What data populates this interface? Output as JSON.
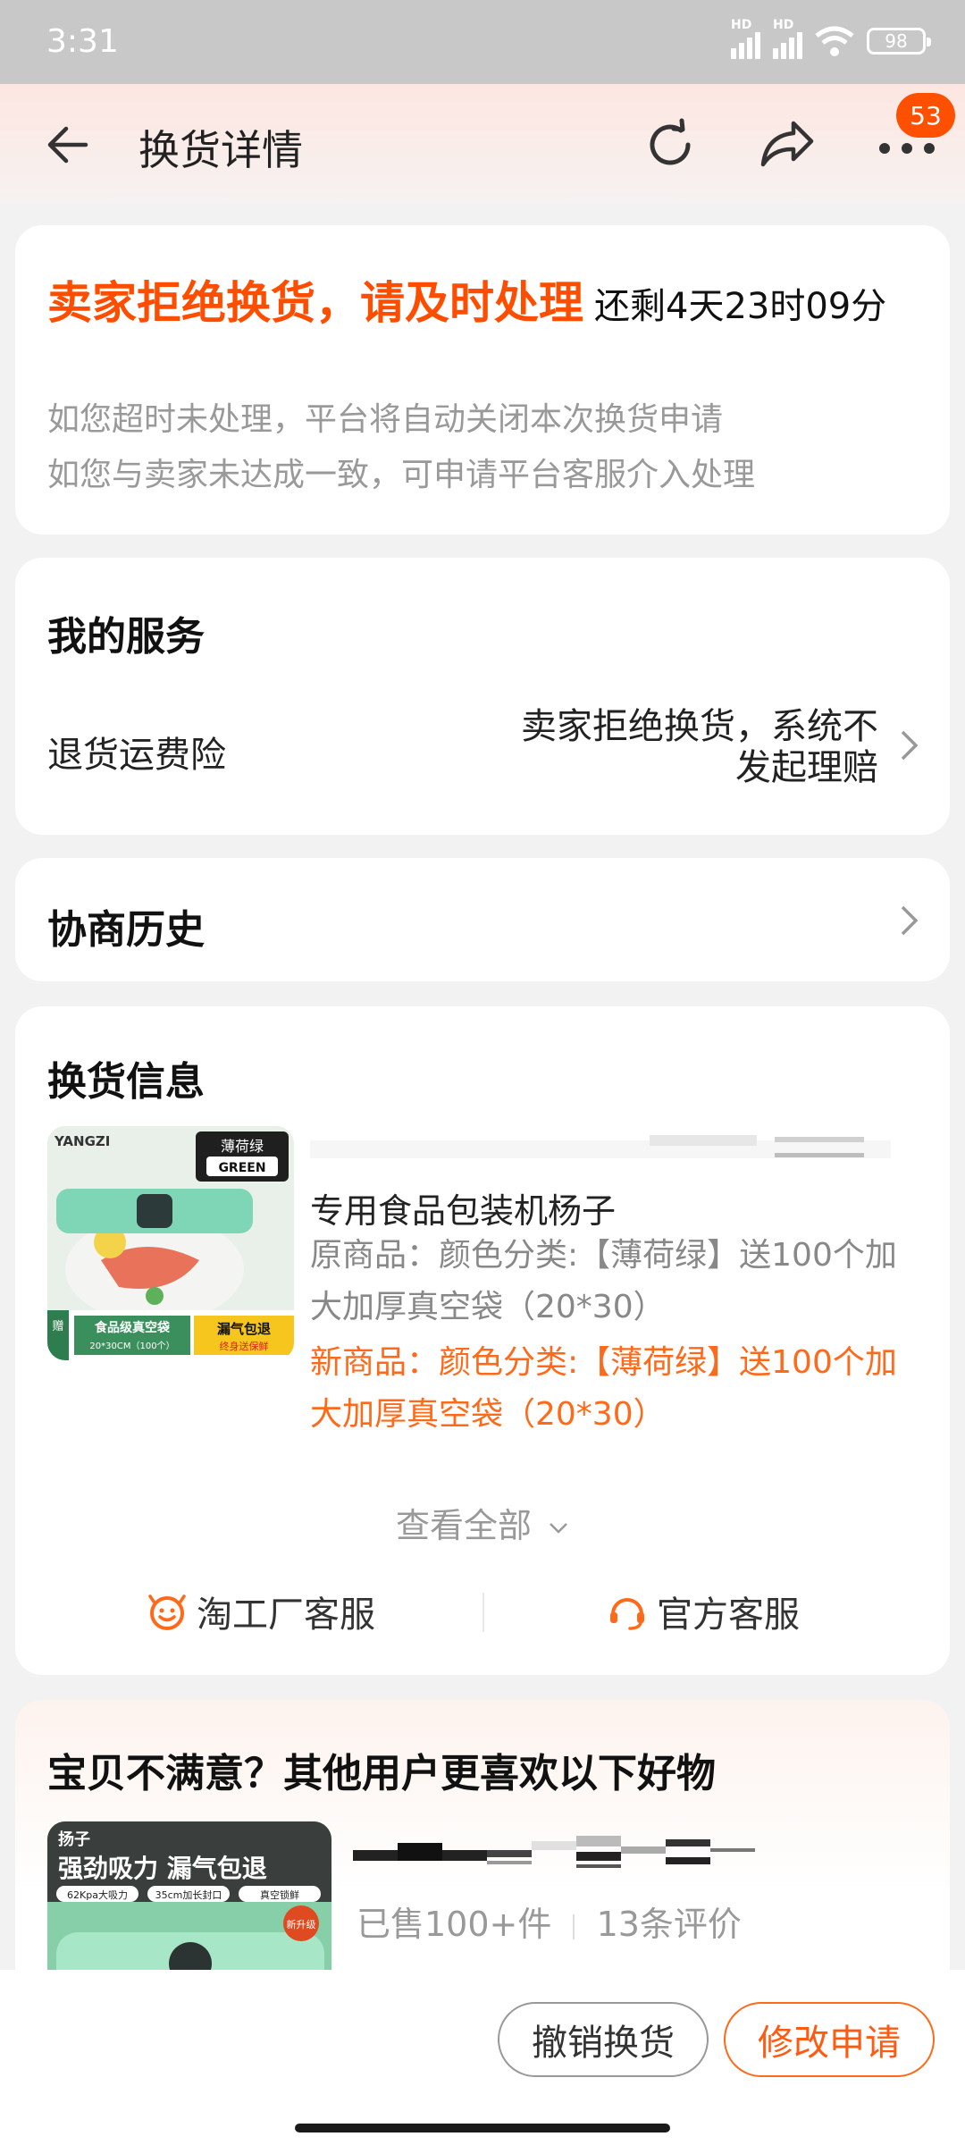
{
  "status_bar": {
    "time": "3:31",
    "battery": "98",
    "hd1": "HD",
    "hd2": "HD"
  },
  "header": {
    "title": "换货详情",
    "badge_count": "53"
  },
  "notice": {
    "title": "卖家拒绝换货，请及时处理",
    "remaining": "还剩4天23时09分",
    "hint1": "如您超时未处理，平台将自动关闭本次换货申请",
    "hint2": "如您与卖家未达成一致，可申请平台客服介入处理"
  },
  "services": {
    "title": "我的服务",
    "item_label": "退货运费险",
    "item_value_line1": "卖家拒绝换货，系统不",
    "item_value_line2": "发起理赔"
  },
  "history": {
    "title": "协商历史"
  },
  "exchange": {
    "title": "换货信息",
    "product_name": "专用食品包装机杨子",
    "original_line1": "原商品：颜色分类:【薄荷绿】送100个加",
    "original_line2": "大加厚真空袋（20*30）",
    "new_line1": "新商品：颜色分类:【薄荷绿】送100个加",
    "new_line2": "大加厚真空袋（20*30）",
    "view_all": "查看全部",
    "service1": "淘工厂客服",
    "service2": "官方客服",
    "thumb_badge_cn": "薄荷绿",
    "thumb_badge_en": "GREEN",
    "thumb_brand": "YANGZI",
    "thumb_banner_left": "食品级真空袋",
    "thumb_banner_sub": "20*30CM（100个）",
    "thumb_banner_right": "漏气包退",
    "thumb_banner_right_sub": "终身送保鲜",
    "thumb_gift": "赠"
  },
  "recommend": {
    "title": "宝贝不满意？其他用户更喜欢以下好物",
    "sold": "已售100+件",
    "reviews": "13条评价",
    "thumb_brand": "扬子",
    "thumb_headline": "强劲吸力 漏气包退",
    "thumb_tag1": "62Kpa大吸力",
    "thumb_tag2": "35cm加长封口",
    "thumb_tag3": "真空锁鲜",
    "thumb_badge": "新升级"
  },
  "actions": {
    "cancel": "撤销换货",
    "modify": "修改申请"
  },
  "colors": {
    "accent": "#ff5000",
    "orange_text": "#ff6a1a",
    "mint": "#7ec9a5"
  }
}
